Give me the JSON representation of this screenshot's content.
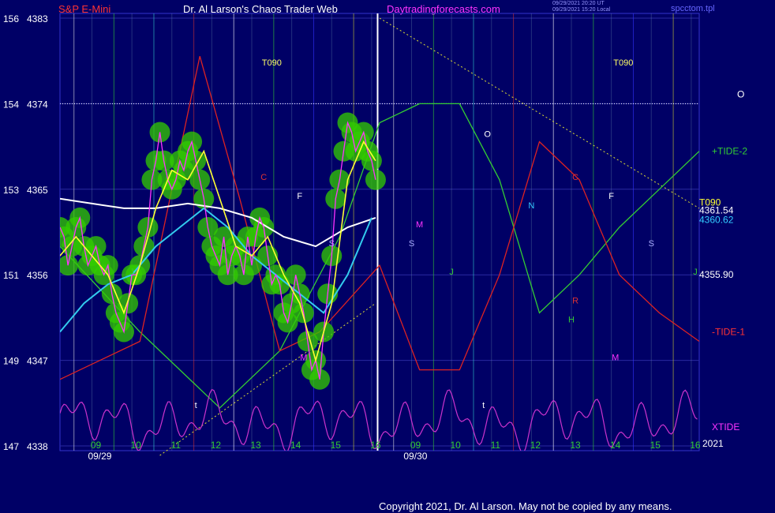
{
  "header": {
    "instrument": "S&P E-Mini",
    "site": "Dr. Al Larson's Chaos Trader Web",
    "url": "Daytradingforecasts.com",
    "stamp1": "09/29/2021 20:20 UT",
    "stamp2": "09/29/2021 15:20 Local",
    "logo": "spcctom.tpl"
  },
  "copyright": "Copyright 2021, Dr. Al Larson. May not be copied by any means.",
  "colors": {
    "background": "#000066",
    "grid": "#2a2aa0",
    "price": "#ff33ff",
    "smooth_yellow": "#ffff33",
    "cyan_ma": "#33ccee",
    "white_ma": "#ffffff",
    "flux_green": "#33cc00",
    "tide_plus2": "#33cc33",
    "tide_minus1": "#dd2222",
    "xtide": "#cc33cc",
    "accent_text": "#ff33ff"
  },
  "chart_data": {
    "type": "line",
    "title": "S&P E-Mini",
    "ylim": [
      4338,
      4383
    ],
    "y_ticks": [
      {
        "left": "156",
        "price": "4383",
        "value": 4383
      },
      {
        "left": "154",
        "price": "4374",
        "value": 4374
      },
      {
        "left": "153",
        "price": "4365",
        "value": 4365
      },
      {
        "left": "151",
        "price": "4356",
        "value": 4356
      },
      {
        "left": "149",
        "price": "4347",
        "value": 4347
      },
      {
        "left": "147",
        "price": "4338",
        "value": 4338
      }
    ],
    "x_hours": [
      {
        "label": "09",
        "t": 0.9
      },
      {
        "label": "10",
        "t": 1.9
      },
      {
        "label": "11",
        "t": 2.9
      },
      {
        "label": "12",
        "t": 3.9
      },
      {
        "label": "13",
        "t": 4.9
      },
      {
        "label": "14",
        "t": 5.9
      },
      {
        "label": "15",
        "t": 6.9
      },
      {
        "label": "16",
        "t": 7.9
      },
      {
        "label": "09",
        "t": 8.9
      },
      {
        "label": "10",
        "t": 9.9
      },
      {
        "label": "11",
        "t": 10.9
      },
      {
        "label": "12",
        "t": 11.9
      },
      {
        "label": "13",
        "t": 12.9
      },
      {
        "label": "14",
        "t": 13.9
      },
      {
        "label": "15",
        "t": 14.9
      },
      {
        "label": "16",
        "t": 15.9
      }
    ],
    "x_dates": [
      {
        "label": "09/29",
        "t": 0.7
      },
      {
        "label": "09/30",
        "t": 8.6
      }
    ],
    "year_label": "2021",
    "series": [
      {
        "name": "price",
        "t": [
          0,
          0.1,
          0.2,
          0.3,
          0.4,
          0.5,
          0.6,
          0.7,
          0.8,
          0.9,
          1.0,
          1.1,
          1.2,
          1.3,
          1.4,
          1.5,
          1.6,
          1.7,
          1.8,
          1.9,
          2.0,
          2.1,
          2.2,
          2.3,
          2.4,
          2.5,
          2.6,
          2.7,
          2.8,
          2.9,
          3.0,
          3.1,
          3.2,
          3.3,
          3.4,
          3.5,
          3.6,
          3.7,
          3.8,
          3.9,
          4.0,
          4.1,
          4.2,
          4.3,
          4.4,
          4.5,
          4.6,
          4.7,
          4.8,
          4.9,
          5.0,
          5.1,
          5.2,
          5.3,
          5.4,
          5.5,
          5.6,
          5.7,
          5.8,
          5.9,
          6.0,
          6.1,
          6.2,
          6.3,
          6.4,
          6.5,
          6.6,
          6.7,
          6.8,
          6.9,
          7.0,
          7.1,
          7.2,
          7.3,
          7.4,
          7.5,
          7.6,
          7.7,
          7.8,
          7.9
        ],
        "values": [
          4361,
          4360,
          4357,
          4359,
          4361,
          4362,
          4359,
          4357,
          4358,
          4359,
          4357,
          4356,
          4357,
          4354,
          4352,
          4351,
          4350,
          4353,
          4356,
          4356,
          4357,
          4359,
          4361,
          4366,
          4368,
          4371,
          4368,
          4366,
          4365,
          4366,
          4368,
          4367,
          4369,
          4370,
          4368,
          4366,
          4364,
          4361,
          4359,
          4358,
          4357,
          4360,
          4356,
          4358,
          4359,
          4358,
          4356,
          4360,
          4357,
          4360,
          4362,
          4361,
          4358,
          4355,
          4356,
          4355,
          4352,
          4351,
          4353,
          4356,
          4354,
          4352,
          4349,
          4346,
          4347,
          4345,
          4350,
          4354,
          4358,
          4364,
          4366,
          4369,
          4372,
          4371,
          4369,
          4370,
          4371,
          4369,
          4368,
          4366
        ]
      },
      {
        "name": "smoothed",
        "t": [
          0,
          0.4,
          0.8,
          1.2,
          1.6,
          2.0,
          2.4,
          2.8,
          3.2,
          3.6,
          4.0,
          4.4,
          4.8,
          5.2,
          5.6,
          6.0,
          6.4,
          6.8,
          7.2,
          7.6,
          7.9
        ],
        "values": [
          4358,
          4360,
          4358,
          4356,
          4352,
          4357,
          4363,
          4367,
          4366,
          4369,
          4364,
          4359,
          4358,
          4360,
          4356,
          4353,
          4347,
          4353,
          4366,
          4370,
          4368
        ]
      },
      {
        "name": "cyan_ma",
        "t": [
          0,
          0.6,
          1.2,
          1.8,
          2.4,
          3.0,
          3.6,
          4.2,
          4.8,
          5.4,
          6.0,
          6.6,
          7.2,
          7.8
        ],
        "values": [
          4350,
          4353,
          4355,
          4356,
          4359,
          4361,
          4363,
          4361,
          4358,
          4356,
          4354,
          4352,
          4356,
          4362
        ]
      },
      {
        "name": "white_ma",
        "t": [
          0,
          0.8,
          1.6,
          2.4,
          3.2,
          4.0,
          4.8,
          5.6,
          6.4,
          7.2,
          7.9
        ],
        "values": [
          4364,
          4363.5,
          4363,
          4363,
          4363.5,
          4363,
          4362,
          4360,
          4359,
          4361,
          4362
        ]
      },
      {
        "name": "+TIDE-2",
        "t": [
          0,
          2,
          4,
          5.5,
          7,
          8,
          9,
          10,
          11,
          12,
          13,
          14,
          15,
          16
        ],
        "values": [
          4359,
          4350,
          4342,
          4348,
          4360,
          4372,
          4374,
          4374,
          4366,
          4352,
          4356,
          4361,
          4365,
          4369
        ]
      },
      {
        "name": "-TIDE-1",
        "t": [
          0,
          2,
          3.5,
          4.5,
          5.5,
          6.5,
          8,
          9,
          10,
          11,
          12,
          13,
          14,
          15,
          16
        ],
        "values": [
          4345,
          4349,
          4379,
          4364,
          4348,
          4350,
          4357,
          4346,
          4346,
          4356,
          4370,
          4366,
          4356,
          4352,
          4349
        ]
      },
      {
        "name": "XTIDE",
        "t": [
          0,
          16
        ],
        "values": [
          4340,
          4340
        ]
      }
    ],
    "labels_right": [
      {
        "text": "O",
        "value": 4375
      },
      {
        "text": "+TIDE-2",
        "value": 4369
      },
      {
        "text": "T090",
        "value": 4363.6
      },
      {
        "text": "4361.54",
        "value": 4362.8
      },
      {
        "text": "4360.62",
        "value": 4361.8
      },
      {
        "text": "4355.90",
        "value": 4356
      },
      {
        "text": "-TIDE-1",
        "value": 4350
      },
      {
        "text": "XTIDE",
        "value": 4340
      }
    ],
    "markers": [
      {
        "text": "T090",
        "t": 5.3,
        "value": 4378
      },
      {
        "text": "T090",
        "t": 14.1,
        "value": 4378
      },
      {
        "text": "C",
        "t": 5.1,
        "value": 4366
      },
      {
        "text": "C",
        "t": 12.9,
        "value": 4366
      },
      {
        "text": "F",
        "t": 6.0,
        "value": 4364
      },
      {
        "text": "F",
        "t": 13.8,
        "value": 4364
      },
      {
        "text": "O",
        "t": 10.7,
        "value": 4370.5
      },
      {
        "text": "N",
        "t": 11.8,
        "value": 4363
      },
      {
        "text": "S",
        "t": 6.8,
        "value": 4359
      },
      {
        "text": "S",
        "t": 8.8,
        "value": 4359
      },
      {
        "text": "S",
        "t": 14.8,
        "value": 4359
      },
      {
        "text": "J",
        "t": 1.8,
        "value": 4356
      },
      {
        "text": "J",
        "t": 9.8,
        "value": 4356
      },
      {
        "text": "J",
        "t": 15.9,
        "value": 4356
      },
      {
        "text": "R",
        "t": 12.9,
        "value": 4353
      },
      {
        "text": "H",
        "t": 12.8,
        "value": 4351
      },
      {
        "text": "M",
        "t": 6.1,
        "value": 4347
      },
      {
        "text": "M",
        "t": 13.9,
        "value": 4347
      },
      {
        "text": "t",
        "t": 3.4,
        "value": 4342
      },
      {
        "text": "t",
        "t": 10.6,
        "value": 4342
      },
      {
        "text": "M",
        "t": 9.0,
        "value": 4361
      }
    ]
  }
}
